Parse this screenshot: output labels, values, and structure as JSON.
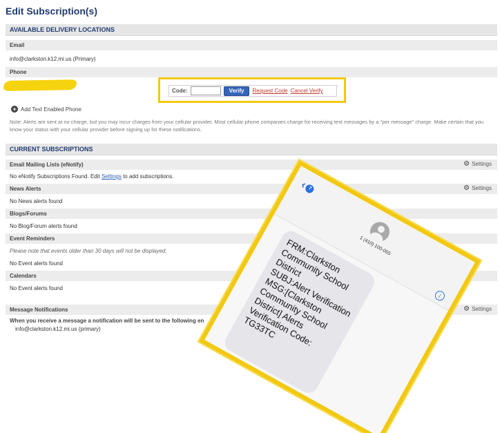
{
  "page": {
    "title": "Edit Subscription(s)"
  },
  "delivery": {
    "header": "AVAILABLE DELIVERY LOCATIONS",
    "email_label": "Email",
    "email_value": "info@clarkston.k12.mi.us  (Primary)",
    "phone_label": "Phone",
    "code_label": "Code:",
    "code_value": "",
    "verify_button": "Verify",
    "request_code": "Request Code",
    "cancel_verify": "Cancel Verify",
    "add_phone": "Add Text Enabled Phone",
    "note": "Note: Alerts are sent at no charge, but you may incur charges from your cellular provider. Most cellular phone companies charge for receiving text messages by a \"per message\" charge. Make certain that you know your status with your cellular provider before signing up for these notifications."
  },
  "subscriptions": {
    "header": "CURRENT SUBSCRIPTIONS",
    "settings_label": "Settings",
    "email_lists": {
      "title": "Email Mailing Lists (eNotify)",
      "text_before": "No eNotify Subscriptions Found. Edit ",
      "link": "Settings",
      "text_after": " to add subscriptions."
    },
    "news": {
      "title": "News Alerts",
      "text": "No News alerts found"
    },
    "blogs": {
      "title": "Blogs/Forums",
      "text": "No Blog/Forum alerts found"
    },
    "events": {
      "title": "Event Reminders",
      "note": "Please note that events older than 30 days will not be displayed.",
      "text": "No Event alerts found"
    },
    "calendars": {
      "title": "Calendars",
      "text": "No Event alerts found"
    },
    "messages": {
      "title": "Message Notifications",
      "text": "When you receive a message a notification will be sent to the following en",
      "email": "info@clarkston.k12.mi.us (primary)"
    }
  },
  "phone": {
    "badge": "7",
    "number": "1 (410) 100-055",
    "message_lines": [
      "FRM:Clarkston",
      "Community School",
      "District",
      "SUBJ:Alert Verification",
      "MSG:[Clarkston",
      "Community School",
      "District] Alerts",
      "Verification Code:",
      "TG33TC"
    ]
  },
  "colors": {
    "highlight": "#f2c811",
    "accent": "#1f3a6e",
    "link": "#c0392b",
    "button": "#3565b8"
  }
}
